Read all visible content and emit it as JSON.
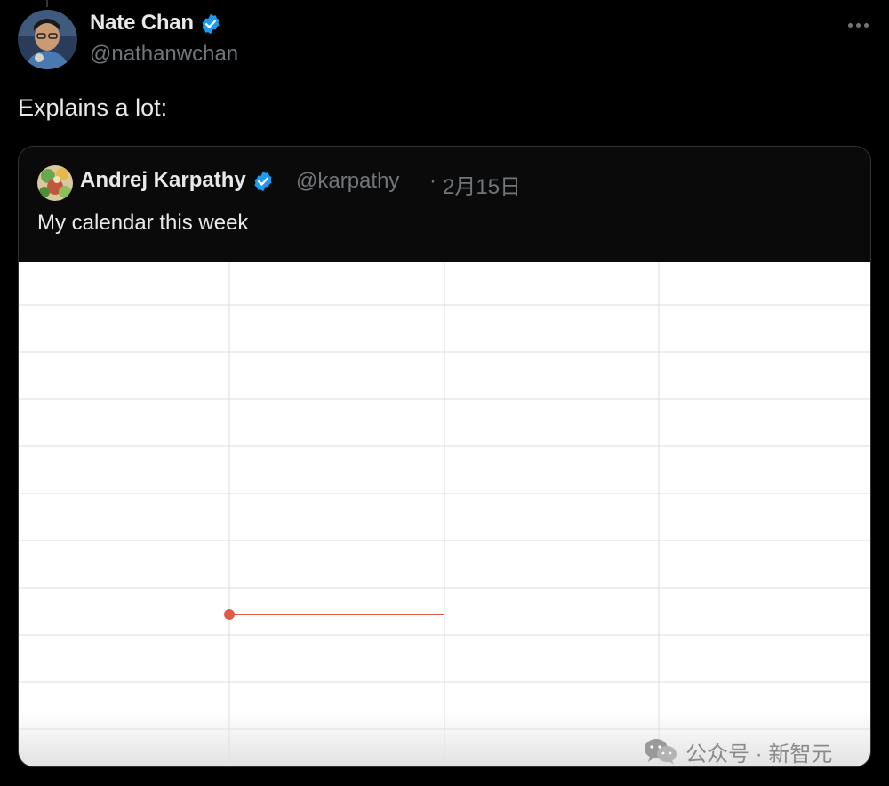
{
  "tweet": {
    "author_name": "Nate Chan",
    "author_handle": "@nathanwchan",
    "text": "Explains a lot:",
    "more_icon": "more-horizontal-icon"
  },
  "quote": {
    "author_name": "Andrej Karpathy",
    "author_handle": "@karpathy",
    "separator": "·",
    "date": "2月15日",
    "text": "My calendar this week"
  },
  "colors": {
    "background": "#000000",
    "verified": "#1d9bf0",
    "handle": "#71767b",
    "now_indicator": "#e05a4a",
    "grid_line": "#dadce0"
  },
  "calendar": {
    "columns": 4,
    "rows": 10,
    "now_indicator_column": 1,
    "now_indicator_row_fraction": 0.55
  },
  "watermark": {
    "text": "公众号 · 新智元",
    "icon": "wechat-icon"
  }
}
